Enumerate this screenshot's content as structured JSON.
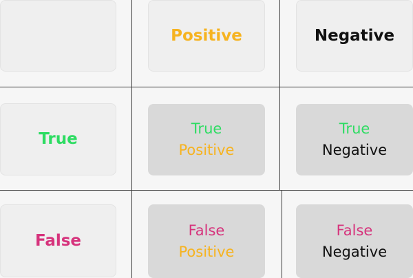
{
  "colors": {
    "positive": "#f6b320",
    "negative": "#111111",
    "true": "#2ddc62",
    "false": "#d6337c"
  },
  "headers": {
    "columns": [
      "Positive",
      "Negative"
    ],
    "rows": [
      "True",
      "False"
    ]
  },
  "cells": [
    [
      "True",
      "Positive"
    ],
    [
      "True",
      "Negative"
    ],
    [
      "False",
      "Positive"
    ],
    [
      "False",
      "Negative"
    ]
  ]
}
